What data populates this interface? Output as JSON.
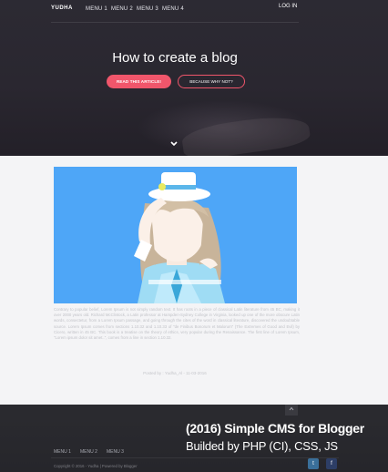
{
  "nav": {
    "brand": "YUDHA",
    "menu": [
      "MENU 1",
      "MENU 2",
      "MENU 3",
      "MENU 4"
    ],
    "login": "LOG IN"
  },
  "hero": {
    "title": "How to create a blog",
    "primary_button": "READ THIS ARTICLE!",
    "secondary_button": "BECAUSE WHY NOT?",
    "scroll_icon": "chevron-down-icon"
  },
  "article": {
    "image_alt_colors": {
      "background": "#4ea6f7"
    },
    "body": "Contrary to popular belief, Lorem Ipsum is not simply random text. It has roots in a piece of classical Latin literature from 45 BC, making it over 2000 years old. Richard McClintock, a Latin professor at Hampden-Sydney College in Virginia, looked up one of the more obscure Latin words, consectetur, from a Lorem Ipsum passage, and going through the cites of the word in classical literature, discovered the undoubtable source. Lorem Ipsum comes from sections 1.10.32 and 1.10.33 of \"de Finibus Bonorum et Malorum\" (The Extremes of Good and Evil) by Cicero, written in 45 BC. This book is a treatise on the theory of ethics, very popular during the Renaissance. The first line of Lorem Ipsum, \"Lorem ipsum dolor sit amet..\", comes from a line in section 1.10.32.",
    "posted": "Posted by : Yudha_Al - 11-03-2016"
  },
  "footer": {
    "menu": [
      "MENU 1",
      "MENU 2",
      "MENU 3"
    ],
    "copyright": "Copyright © 2016 - Yudha | Powered by Blogger",
    "social": [
      {
        "icon": "twitter-icon",
        "glyph": "t"
      },
      {
        "icon": "facebook-icon",
        "glyph": "f"
      }
    ],
    "scroll_top_icon": "chevron-up-icon"
  },
  "caption": {
    "title": "(2016) Simple CMS for Blogger",
    "subtitle": "Builded by PHP (CI), CSS, JS"
  },
  "colors": {
    "accent": "#f0566b",
    "hero_bg": "#2a2730",
    "image_bg": "#4ea6f7",
    "footer_bg": "#2a2a2f"
  }
}
